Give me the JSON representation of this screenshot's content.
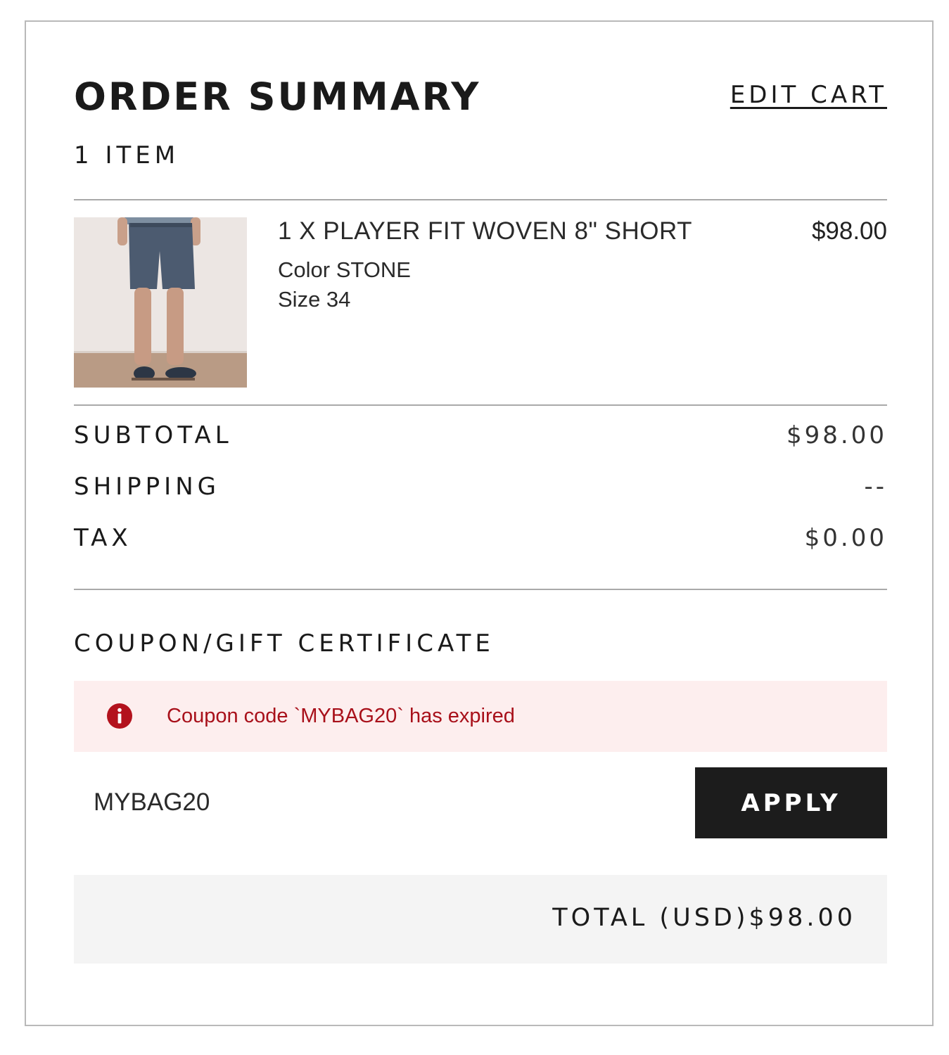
{
  "order_summary": {
    "title": "ORDER SUMMARY",
    "edit_cart_label": "EDIT CART",
    "item_count": "1 ITEM"
  },
  "product": {
    "name": "1 X PLAYER FIT WOVEN 8\" SHORT",
    "color": "Color STONE",
    "size": "Size 34",
    "price": "$98.00"
  },
  "summary": {
    "rows": [
      {
        "label": "SUBTOTAL",
        "value": "$98.00"
      },
      {
        "label": "SHIPPING",
        "value": "--"
      },
      {
        "label": "TAX",
        "value": "$0.00"
      }
    ]
  },
  "coupon": {
    "heading": "COUPON/GIFT CERTIFICATE",
    "error_message": "Coupon code `MYBAG20` has expired",
    "input_value": "MYBAG20",
    "apply_label": "APPLY",
    "error_icon": "info-icon"
  },
  "total": {
    "label": "TOTAL (USD)",
    "value": "$98.00"
  },
  "colors": {
    "error_text": "#a8101a",
    "error_background": "#fdeeee",
    "button_background": "#1c1c1c",
    "total_background": "#f4f4f4"
  }
}
